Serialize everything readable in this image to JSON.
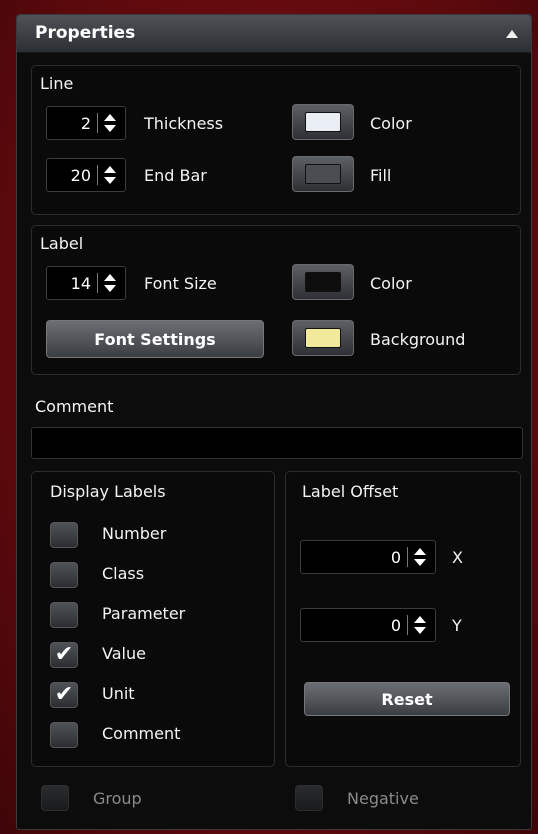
{
  "panel": {
    "title": "Properties",
    "collapse_icon": "chevron-up-icon"
  },
  "line": {
    "heading": "Line",
    "thickness": {
      "value": "2",
      "label": "Thickness"
    },
    "end_bar": {
      "value": "20",
      "label": "End Bar"
    },
    "color": {
      "label": "Color",
      "swatch": "#e8eef4"
    },
    "fill": {
      "label": "Fill",
      "swatch": "#4a4e53"
    }
  },
  "label": {
    "heading": "Label",
    "font_size": {
      "value": "14",
      "label": "Font Size"
    },
    "font_settings_button": "Font Settings",
    "color": {
      "label": "Color",
      "swatch": "#0e0e0e"
    },
    "background": {
      "label": "Background",
      "swatch": "#f2ea9a"
    }
  },
  "comment": {
    "heading": "Comment",
    "value": ""
  },
  "display_labels": {
    "heading": "Display Labels",
    "items": [
      {
        "label": "Number",
        "checked": false
      },
      {
        "label": "Class",
        "checked": false
      },
      {
        "label": "Parameter",
        "checked": false
      },
      {
        "label": "Value",
        "checked": true
      },
      {
        "label": "Unit",
        "checked": true
      },
      {
        "label": "Comment",
        "checked": false
      }
    ]
  },
  "label_offset": {
    "heading": "Label Offset",
    "x": {
      "value": "0",
      "axis": "X"
    },
    "y": {
      "value": "0",
      "axis": "Y"
    },
    "reset_button": "Reset"
  },
  "footer": {
    "group": {
      "label": "Group",
      "checked": false,
      "enabled": false
    },
    "negative": {
      "label": "Negative",
      "checked": false,
      "enabled": false
    }
  }
}
